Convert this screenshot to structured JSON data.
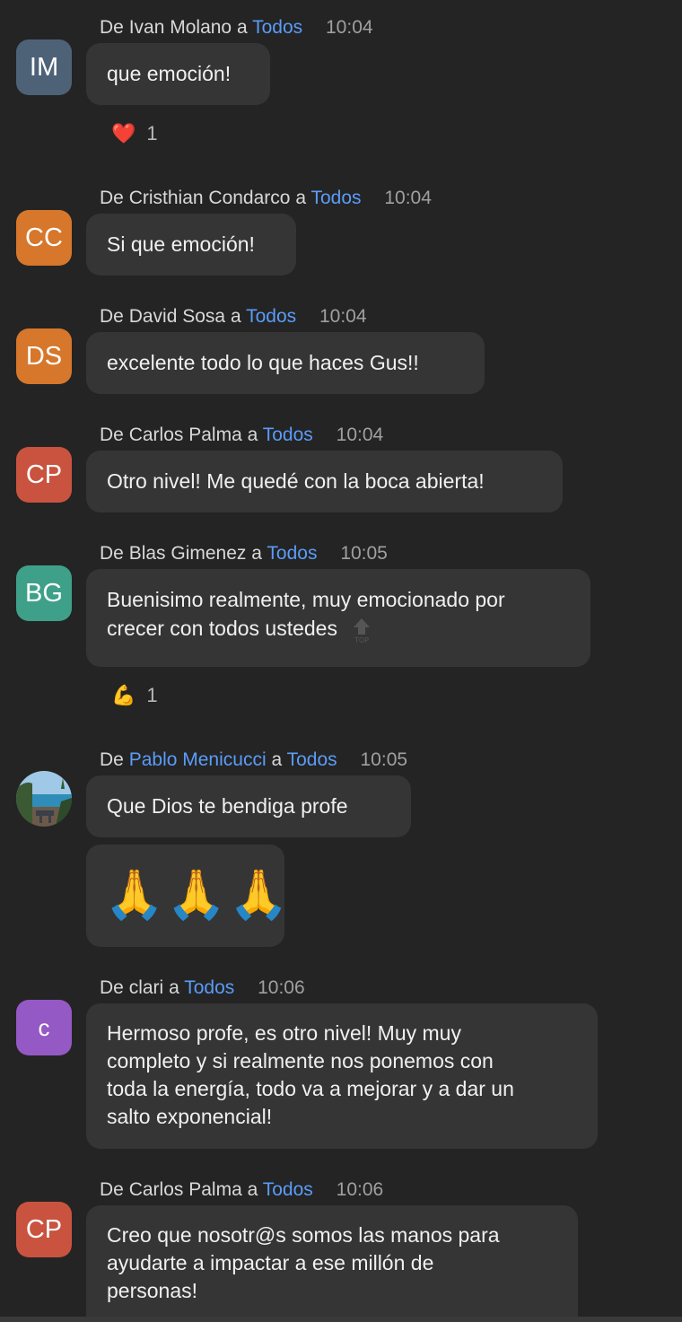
{
  "labels": {
    "from": "De",
    "to": "a"
  },
  "messages": [
    {
      "sender": "Ivan Molano",
      "recipient": "Todos",
      "time": "10:04",
      "initials": "IM",
      "avatar_color": "#4e6277",
      "text": "que emoción!",
      "reaction": {
        "emoji": "❤️",
        "count": "1"
      }
    },
    {
      "sender": "Cristhian Condarco",
      "recipient": "Todos",
      "time": "10:04",
      "initials": "CC",
      "avatar_color": "#d6772b",
      "text": "Si que emoción!"
    },
    {
      "sender": "David Sosa",
      "recipient": "Todos",
      "time": "10:04",
      "initials": "DS",
      "avatar_color": "#d6772b",
      "text": "excelente todo lo que haces Gus!!"
    },
    {
      "sender": "Carlos Palma",
      "recipient": "Todos",
      "time": "10:04",
      "initials": "CP",
      "avatar_color": "#c9533f",
      "text": "Otro nivel! Me quedé con la boca abierta!"
    },
    {
      "sender": "Blas Gimenez",
      "recipient": "Todos",
      "time": "10:05",
      "initials": "BG",
      "avatar_color": "#3fa08a",
      "text_line1": "Buenisimo realmente, muy emocionado por",
      "text_line2": "crecer con todos ustedes",
      "reaction": {
        "emoji": "💪",
        "count": "1"
      }
    },
    {
      "sender": "Pablo Menicucci",
      "recipient": "Todos",
      "time": "10:05",
      "text": "Que Dios te bendiga profe",
      "emoji_message": "🙏🙏🙏"
    },
    {
      "sender": "clari",
      "recipient": "Todos",
      "time": "10:06",
      "initials": "c",
      "avatar_color": "#9459c4",
      "text_lines": [
        "Hermoso profe, es otro nivel! Muy muy",
        "completo y si realmente nos ponemos con",
        "toda la energía, todo va a mejorar y a dar un",
        "salto exponencial!"
      ]
    },
    {
      "sender": "Carlos Palma",
      "recipient": "Todos",
      "time": "10:06",
      "initials": "CP",
      "avatar_color": "#c9533f",
      "text_lines": [
        "Creo que nosotr@s somos las manos para",
        "ayudarte a impactar a ese millón de",
        "personas!"
      ]
    }
  ]
}
